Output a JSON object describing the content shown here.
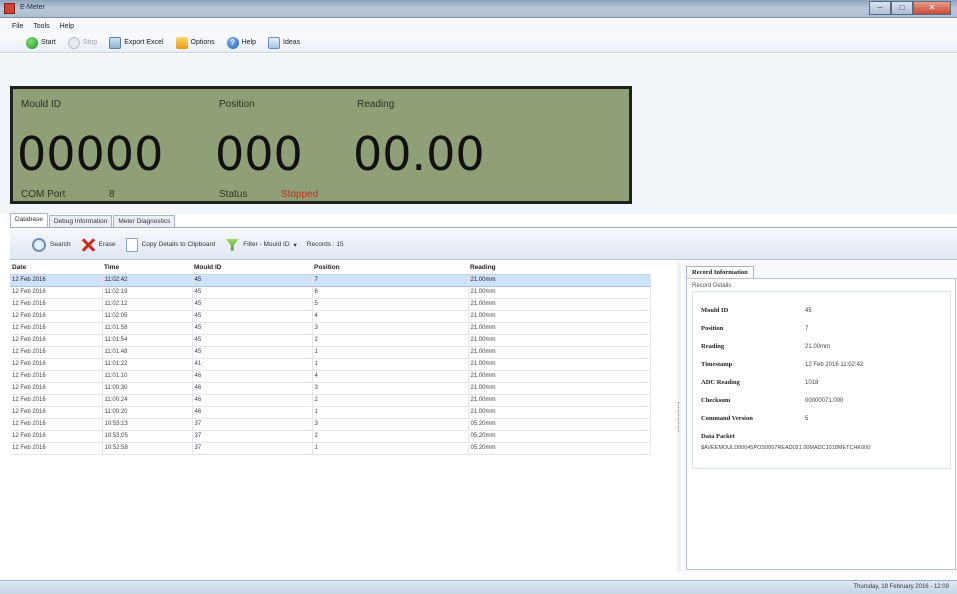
{
  "window": {
    "title": "E-Meter"
  },
  "menu": [
    "File",
    "Tools",
    "Help"
  ],
  "toolbar": {
    "start": "Start",
    "stop": "Stop",
    "export": "Export Excel",
    "options": "Options",
    "help": "Help",
    "ideas": "Ideas"
  },
  "display": {
    "mould_label": "Mould ID",
    "position_label": "Position",
    "reading_label": "Reading",
    "mould_value": "00000",
    "position_value": "000",
    "reading_value": "00.00",
    "com_label": "COM Port",
    "com_value": "8",
    "status_label": "Status",
    "status_value": "Stopped"
  },
  "tabs": [
    "Database",
    "Debug Information",
    "Meter Diagnostics"
  ],
  "db_toolbar": {
    "search": "Search",
    "erase": "Erase",
    "copy": "Copy Details to Clipboard",
    "filter": "Filter - Mould ID",
    "records": "Records : 15"
  },
  "grid": {
    "columns": [
      "Date",
      "Time",
      "Mould ID",
      "Position",
      "Reading"
    ],
    "rows": [
      [
        "12 Feb 2016",
        "11:02:42",
        "45",
        "7",
        "21.00mm"
      ],
      [
        "12 Feb 2016",
        "11:02:19",
        "45",
        "6",
        "21.00mm"
      ],
      [
        "12 Feb 2016",
        "11:02:12",
        "45",
        "5",
        "21.00mm"
      ],
      [
        "12 Feb 2016",
        "11:02:05",
        "45",
        "4",
        "21.00mm"
      ],
      [
        "12 Feb 2016",
        "11:01:58",
        "45",
        "3",
        "21.00mm"
      ],
      [
        "12 Feb 2016",
        "11:01:54",
        "45",
        "2",
        "21.00mm"
      ],
      [
        "12 Feb 2016",
        "11:01:48",
        "45",
        "1",
        "21.00mm"
      ],
      [
        "12 Feb 2016",
        "11:01:22",
        "41",
        "1",
        "21.00mm"
      ],
      [
        "12 Feb 2016",
        "11:01:10",
        "46",
        "4",
        "21.00mm"
      ],
      [
        "12 Feb 2016",
        "11:00:30",
        "46",
        "3",
        "21.00mm"
      ],
      [
        "12 Feb 2016",
        "11:00:24",
        "46",
        "2",
        "21.00mm"
      ],
      [
        "12 Feb 2016",
        "11:00:20",
        "46",
        "1",
        "21.00mm"
      ],
      [
        "12 Feb 2016",
        "10:53:13",
        "37",
        "3",
        "05.20mm"
      ],
      [
        "12 Feb 2016",
        "10:53:05",
        "37",
        "2",
        "05.20mm"
      ],
      [
        "12 Feb 2016",
        "10:52:58",
        "37",
        "1",
        "05.20mm"
      ]
    ]
  },
  "details": {
    "tab": "Record Information",
    "group": "Record Details",
    "mould_id_label": "Mould ID",
    "mould_id_value": "45",
    "position_label": "Position",
    "position_value": "7",
    "reading_label": "Reading",
    "reading_value": "21.00mm",
    "timestamp_label": "Timestamp",
    "timestamp_value": "12 Feb 2016 11:02:42",
    "adc_label": "ADC Reading",
    "adc_value": "1018",
    "checksum_label": "Checksum",
    "checksum_value": "00000071.000",
    "command_label": "Command Version",
    "command_value": "5",
    "packet_label": "Data Packet",
    "packet_value": "$AVEEMOULD00045POS0007READ021.00MADC1018METCHK000"
  },
  "statusbar": {
    "date": "Thursday, 18 February 2016 - 12:09"
  }
}
